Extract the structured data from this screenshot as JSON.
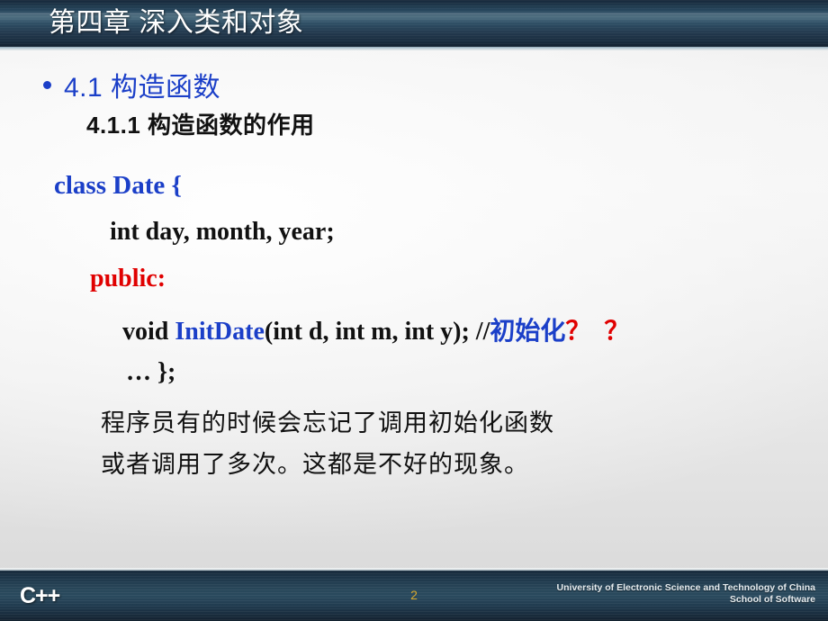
{
  "header": {
    "title": "第四章 深入类和对象"
  },
  "body": {
    "bullet_heading": "4.1 构造函数",
    "sub_heading": "4.1.1 构造函数的作用",
    "code": {
      "class_decl": "class Date {",
      "fields": "int day, month, year;",
      "access_specifier": "public:",
      "method_keyword": "void ",
      "method_name": "InitDate",
      "method_params": "(int d, int m, int y);  //",
      "method_comment_cn": "初始化",
      "method_comment_marks": "？ ？",
      "ellipsis_line": "…      };"
    },
    "notes": [
      "程序员有的时候会忘记了调用初始化函数",
      "或者调用了多次。这都是不好的现象。"
    ]
  },
  "footer": {
    "brand": "C++",
    "page_number": "2",
    "org_line1": "University of Electronic Science and Technology of China",
    "org_line2": "School of Software"
  },
  "colors": {
    "accent_blue": "#1b3fc8",
    "accent_red": "#e00000",
    "header_dark": "#1c3346",
    "page_number_gold": "#d8a92c"
  }
}
